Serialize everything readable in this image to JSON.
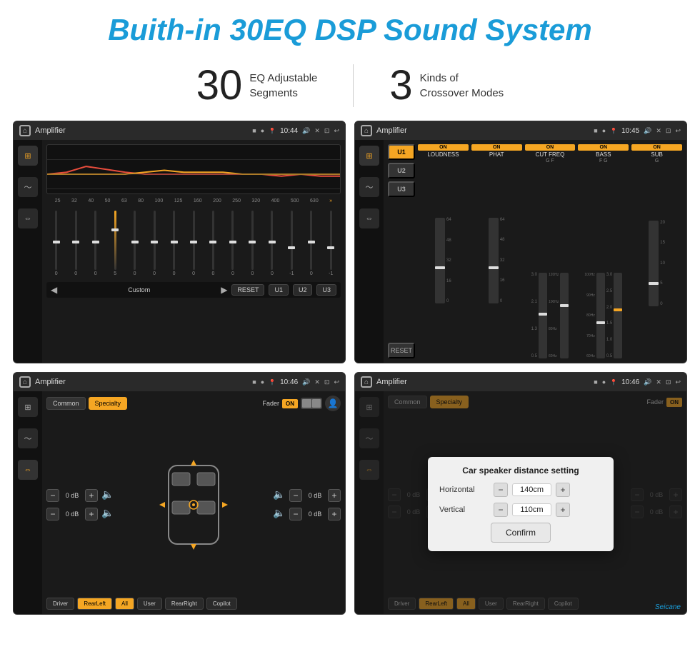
{
  "header": {
    "title": "Buith-in 30EQ DSP Sound System"
  },
  "stats": {
    "eq_number": "30",
    "eq_desc_line1": "EQ Adjustable",
    "eq_desc_line2": "Segments",
    "crossover_number": "3",
    "crossover_desc_line1": "Kinds of",
    "crossover_desc_line2": "Crossover Modes"
  },
  "screen_eq": {
    "title": "Amplifier",
    "time": "10:44",
    "eq_freqs": [
      "25",
      "32",
      "40",
      "50",
      "63",
      "80",
      "100",
      "125",
      "160",
      "200",
      "250",
      "320",
      "400",
      "500",
      "630"
    ],
    "eq_values": [
      "0",
      "0",
      "0",
      "5",
      "0",
      "0",
      "0",
      "0",
      "0",
      "0",
      "0",
      "0",
      "-1",
      "0",
      "-1"
    ],
    "bottom_label": "Custom",
    "btn_reset": "RESET",
    "btn_u1": "U1",
    "btn_u2": "U2",
    "btn_u3": "U3"
  },
  "screen_xover": {
    "title": "Amplifier",
    "time": "10:45",
    "presets": [
      "U1",
      "U2",
      "U3"
    ],
    "channels": [
      {
        "on": true,
        "name": "LOUDNESS"
      },
      {
        "on": true,
        "name": "PHAT"
      },
      {
        "on": true,
        "name": "CUT FREQ",
        "sub": "G    F"
      },
      {
        "on": true,
        "name": "BASS",
        "sub": "F    G"
      },
      {
        "on": true,
        "name": "SUB",
        "sub": "G"
      }
    ],
    "btn_reset": "RESET"
  },
  "screen_fader": {
    "title": "Amplifier",
    "time": "10:46",
    "tab_common": "Common",
    "tab_specialty": "Specialty",
    "fader_label": "Fader",
    "on_label": "ON",
    "rows": [
      {
        "val": "0 dB"
      },
      {
        "val": "0 dB"
      },
      {
        "val": "0 dB"
      },
      {
        "val": "0 dB"
      }
    ],
    "buttons": [
      "Driver",
      "RearLeft",
      "All",
      "User",
      "RearRight",
      "Copilot"
    ]
  },
  "screen_distance": {
    "title": "Amplifier",
    "time": "10:46",
    "tab_common": "Common",
    "tab_specialty": "Specialty",
    "on_label": "ON",
    "dialog": {
      "title": "Car speaker distance setting",
      "horizontal_label": "Horizontal",
      "horizontal_value": "140cm",
      "vertical_label": "Vertical",
      "vertical_value": "110cm",
      "confirm_label": "Confirm",
      "right_rows": [
        "0 dB",
        "0 dB"
      ]
    },
    "buttons": [
      "Driver",
      "RearLeft",
      "User",
      "RearRight",
      "Copilot"
    ]
  },
  "watermark": "Seicane"
}
